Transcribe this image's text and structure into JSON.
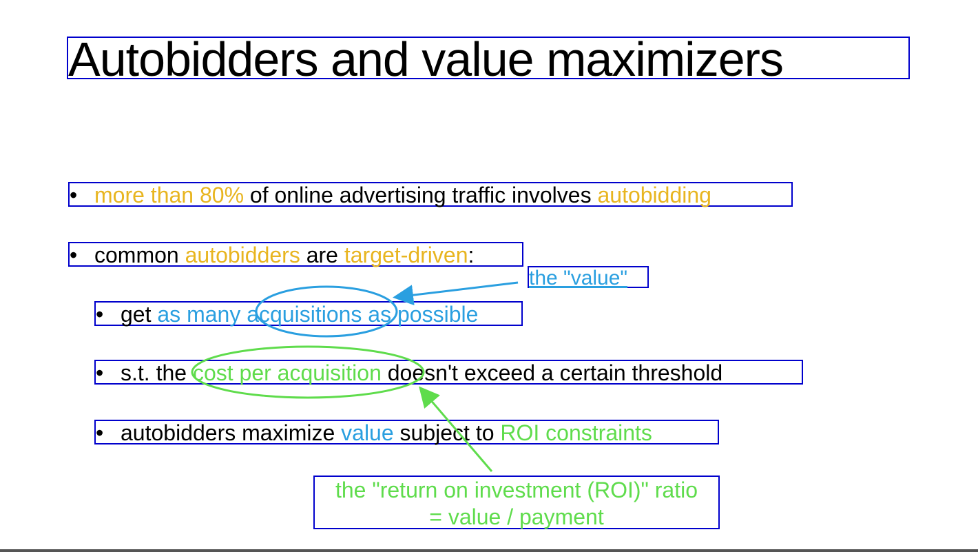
{
  "title": "Autobidders and value maximizers",
  "bullets": {
    "b1": {
      "p1": "more than 80%",
      "p2": " of online advertising traffic involves ",
      "p3": "autobidding"
    },
    "b2": {
      "p1": "common ",
      "p2": "autobidders",
      "p3": " are ",
      "p4": "target-driven",
      "p5": ":"
    },
    "b3": {
      "p1": "get ",
      "p2": "as many ",
      "p3": "acquisitions",
      "p4": " as possible"
    },
    "b4": {
      "p1": "s.t. the ",
      "p2": "cost per acquisition",
      "p3": " doesn't exceed a certain threshold"
    },
    "b5": {
      "p1": "autobidders maximize ",
      "p2": "value",
      "p3": " subject to ",
      "p4": "ROI constraints"
    }
  },
  "annotations": {
    "value": "the \"value\"",
    "roi_line1": "the \"return on investment (ROI)\" ratio",
    "roi_line2": "= value / payment"
  },
  "bullet_char": "•",
  "colors": {
    "orange": "#e8b520",
    "blue": "#2a9fe0",
    "green": "#5fdc4c",
    "box": "#0000cc"
  }
}
